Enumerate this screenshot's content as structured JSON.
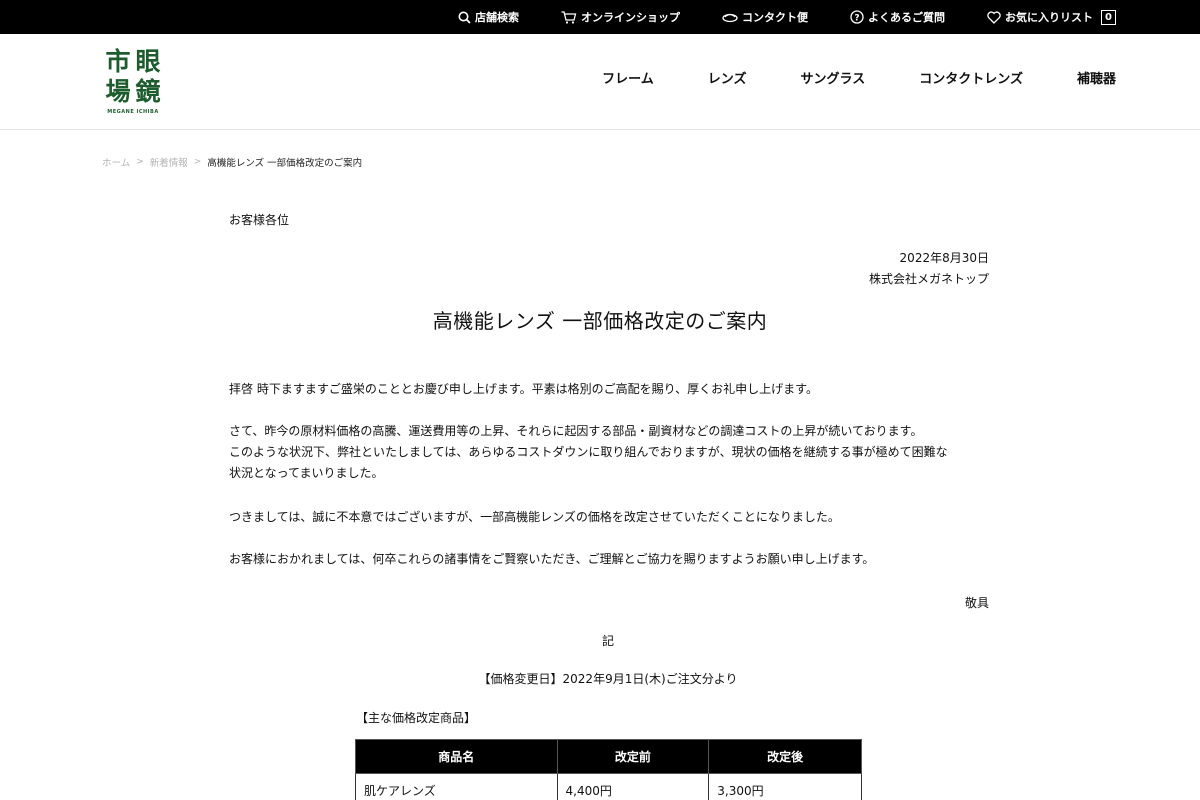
{
  "topbar": {
    "links": [
      {
        "label": "店舗検索",
        "icon": "search-icon"
      },
      {
        "label": "オンラインショップ",
        "icon": "cart-icon"
      },
      {
        "label": "コンタクト便",
        "icon": "contact-lens-icon"
      },
      {
        "label": "よくあるご質問",
        "icon": "question-icon"
      },
      {
        "label": "お気に入りリスト",
        "icon": "heart-icon"
      }
    ],
    "favorites_count": "0"
  },
  "logo": {
    "chars": [
      "市",
      "眼",
      "場",
      "鏡"
    ],
    "subtitle": "MEGANE ICHIBA",
    "brand_color": "#1d5c2d"
  },
  "nav": {
    "items": [
      "フレーム",
      "レンズ",
      "サングラス",
      "コンタクトレンズ",
      "補聴器"
    ]
  },
  "breadcrumb": {
    "items": [
      "ホーム",
      "新着情報"
    ],
    "current": "高機能レンズ 一部価格改定のご案内"
  },
  "notice": {
    "recipient": "お客様各位",
    "date": "2022年8月30日",
    "company": "株式会社メガネトップ",
    "title": "高機能レンズ 一部価格改定のご案内",
    "paragraphs": [
      "拝啓 時下ますますご盛栄のこととお慶び申し上げます。平素は格別のご高配を賜り、厚くお礼申し上げます。",
      "さて、昨今の原材料価格の高騰、運送費用等の上昇、それらに起因する部品・副資材などの調達コストの上昇が続いております。",
      "このような状況下、弊社といたしましては、あらゆるコストダウンに取り組んでおりますが、現状の価格を継続する事が極めて困難な",
      "状況となってまいりました。",
      "つきましては、誠に不本意ではございますが、一部高機能レンズの価格を改定させていただくことになりました。",
      "お客様におかれましては、何卒これらの諸事情をご賢察いただき、ご理解とご協力を賜りますようお願い申し上げます。"
    ],
    "closing": "敬具",
    "ki": "記",
    "change_date": "【価格変更日】2022年9月1日(木)ご注文分より",
    "products_heading": "【主な価格改定商品】"
  },
  "price_table": {
    "headers": [
      "商品名",
      "改定前",
      "改定後"
    ],
    "rows": [
      [
        "肌ケアレンズ",
        "4,400円",
        "3,300円"
      ]
    ]
  }
}
